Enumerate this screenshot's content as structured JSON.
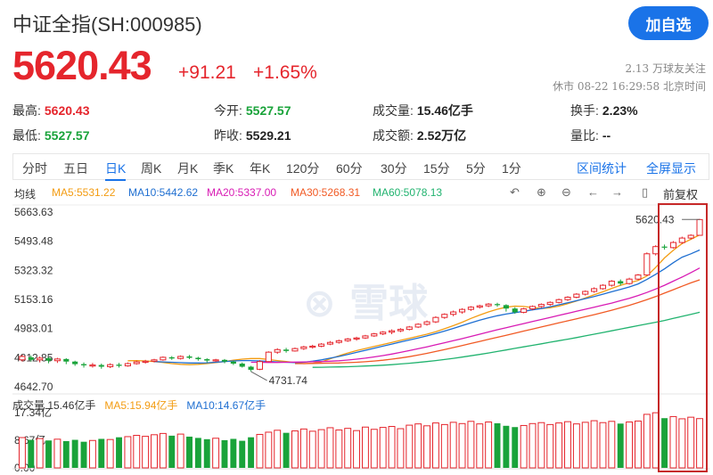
{
  "header": {
    "title": "中证全指(SH:000985)",
    "add_button": "加自选",
    "price": "5620.43",
    "change": "+91.21",
    "change_pct": "+1.65%",
    "followers": "2.13 万球友关注",
    "status": "休市 08-22 16:29:58 北京时间"
  },
  "stats": [
    {
      "label": "最高:",
      "value": "5620.43",
      "tone": "red"
    },
    {
      "label": "今开:",
      "value": "5527.57",
      "tone": "green"
    },
    {
      "label": "成交量:",
      "value": "15.46亿手",
      "tone": "dark"
    },
    {
      "label": "换手:",
      "value": "2.23%",
      "tone": "dark"
    },
    {
      "label": "最低:",
      "value": "5527.57",
      "tone": "green"
    },
    {
      "label": "昨收:",
      "value": "5529.21",
      "tone": "dark"
    },
    {
      "label": "成交额:",
      "value": "2.52万亿",
      "tone": "dark"
    },
    {
      "label": "量比:",
      "value": "--",
      "tone": "dark"
    }
  ],
  "tabs": [
    "分时",
    "五日",
    "日K",
    "周K",
    "月K",
    "季K",
    "年K",
    "120分",
    "60分",
    "30分",
    "15分",
    "5分",
    "1分"
  ],
  "active_tab": "日K",
  "tab_links": [
    "区间统计",
    "全屏显示"
  ],
  "ma_legend": {
    "label": "均线",
    "items": [
      {
        "text": "MA5:5531.22",
        "color": "#f39c12"
      },
      {
        "text": "MA10:5442.62",
        "color": "#1f6fd1"
      },
      {
        "text": "MA20:5337.00",
        "color": "#d81bb4"
      },
      {
        "text": "MA30:5268.31",
        "color": "#f15a24"
      },
      {
        "text": "MA60:5078.13",
        "color": "#21b36f"
      }
    ],
    "adjust": "前复权"
  },
  "colors": {
    "up": "#e5252c",
    "down": "#19a33a",
    "accent": "#1a73e8"
  },
  "volume_legend": [
    {
      "text": "成交量 15.46亿手",
      "color": "#333333"
    },
    {
      "text": "MA5:15.94亿手",
      "color": "#f39c12"
    },
    {
      "text": "MA10:14.67亿手",
      "color": "#1f6fd1"
    }
  ],
  "chart_data": {
    "type": "candlestick",
    "y_ticks": [
      "5663.63",
      "5493.48",
      "5323.32",
      "5153.16",
      "4983.01",
      "4812.85",
      "4642.70"
    ],
    "y_range": [
      4642.7,
      5663.63
    ],
    "high_marker": "5620.43",
    "low_marker": "4731.74",
    "volume_ticks": [
      "17.34亿",
      "8.67亿",
      "0.00"
    ],
    "volume_range": [
      0,
      17.34
    ],
    "candles": [
      [
        4800,
        4820,
        4790,
        4830
      ],
      [
        4815,
        4800,
        4790,
        4825
      ],
      [
        4800,
        4810,
        4785,
        4820
      ],
      [
        4810,
        4795,
        4780,
        4818
      ],
      [
        4795,
        4805,
        4782,
        4812
      ],
      [
        4805,
        4790,
        4775,
        4810
      ],
      [
        4790,
        4775,
        4765,
        4795
      ],
      [
        4775,
        4768,
        4755,
        4785
      ],
      [
        4768,
        4770,
        4755,
        4782
      ],
      [
        4770,
        4760,
        4748,
        4778
      ],
      [
        4760,
        4772,
        4752,
        4780
      ],
      [
        4772,
        4765,
        4755,
        4782
      ],
      [
        4765,
        4778,
        4760,
        4785
      ],
      [
        4778,
        4788,
        4772,
        4795
      ],
      [
        4788,
        4792,
        4778,
        4800
      ],
      [
        4792,
        4800,
        4785,
        4806
      ],
      [
        4800,
        4815,
        4795,
        4820
      ],
      [
        4815,
        4808,
        4800,
        4822
      ],
      [
        4808,
        4820,
        4802,
        4826
      ],
      [
        4820,
        4812,
        4805,
        4828
      ],
      [
        4812,
        4804,
        4795,
        4818
      ],
      [
        4804,
        4796,
        4785,
        4810
      ],
      [
        4796,
        4800,
        4788,
        4806
      ],
      [
        4800,
        4790,
        4780,
        4805
      ],
      [
        4790,
        4778,
        4770,
        4795
      ],
      [
        4778,
        4760,
        4755,
        4785
      ],
      [
        4760,
        4742,
        4732,
        4765
      ],
      [
        4745,
        4790,
        4740,
        4798
      ],
      [
        4790,
        4845,
        4788,
        4850
      ],
      [
        4845,
        4860,
        4835,
        4868
      ],
      [
        4860,
        4852,
        4842,
        4870
      ],
      [
        4852,
        4866,
        4848,
        4872
      ],
      [
        4866,
        4876,
        4858,
        4882
      ],
      [
        4876,
        4880,
        4866,
        4888
      ],
      [
        4880,
        4892,
        4874,
        4898
      ],
      [
        4892,
        4902,
        4886,
        4910
      ],
      [
        4902,
        4912,
        4895,
        4918
      ],
      [
        4912,
        4922,
        4905,
        4928
      ],
      [
        4922,
        4928,
        4912,
        4935
      ],
      [
        4928,
        4940,
        4922,
        4946
      ],
      [
        4940,
        4952,
        4934,
        4958
      ],
      [
        4952,
        4962,
        4945,
        4968
      ],
      [
        4962,
        4970,
        4950,
        4978
      ],
      [
        4970,
        4978,
        4962,
        4985
      ],
      [
        4978,
        4992,
        4972,
        4998
      ],
      [
        4992,
        5008,
        4986,
        5014
      ],
      [
        5008,
        5022,
        5000,
        5030
      ],
      [
        5022,
        5048,
        5015,
        5055
      ],
      [
        5048,
        5066,
        5040,
        5072
      ],
      [
        5066,
        5080,
        5055,
        5088
      ],
      [
        5080,
        5095,
        5070,
        5102
      ],
      [
        5095,
        5108,
        5086,
        5114
      ],
      [
        5108,
        5116,
        5100,
        5122
      ],
      [
        5116,
        5126,
        5108,
        5132
      ],
      [
        5126,
        5120,
        5110,
        5134
      ],
      [
        5120,
        5100,
        5082,
        5125
      ],
      [
        5100,
        5078,
        5070,
        5108
      ],
      [
        5078,
        5098,
        5072,
        5104
      ],
      [
        5098,
        5112,
        5090,
        5118
      ],
      [
        5112,
        5124,
        5104,
        5130
      ],
      [
        5124,
        5136,
        5116,
        5142
      ],
      [
        5136,
        5152,
        5130,
        5158
      ],
      [
        5152,
        5166,
        5144,
        5172
      ],
      [
        5166,
        5184,
        5160,
        5190
      ],
      [
        5184,
        5200,
        5176,
        5206
      ],
      [
        5200,
        5216,
        5192,
        5224
      ],
      [
        5216,
        5236,
        5210,
        5242
      ],
      [
        5236,
        5260,
        5228,
        5266
      ],
      [
        5260,
        5246,
        5234,
        5270
      ],
      [
        5246,
        5272,
        5240,
        5280
      ],
      [
        5272,
        5296,
        5266,
        5302
      ],
      [
        5296,
        5420,
        5292,
        5428
      ],
      [
        5420,
        5462,
        5410,
        5470
      ],
      [
        5462,
        5456,
        5444,
        5474
      ],
      [
        5456,
        5486,
        5450,
        5494
      ],
      [
        5486,
        5512,
        5478,
        5520
      ],
      [
        5512,
        5528,
        5504,
        5534
      ],
      [
        5528,
        5620,
        5527,
        5624
      ]
    ],
    "volumes": [
      9.5,
      8.8,
      9.2,
      8.6,
      9.0,
      8.4,
      8.8,
      8.2,
      8.6,
      9.1,
      8.9,
      9.6,
      9.8,
      10.2,
      9.9,
      10.4,
      10.8,
      10.1,
      10.6,
      9.8,
      9.4,
      9.0,
      9.3,
      8.7,
      9.1,
      8.5,
      9.6,
      10.5,
      11.2,
      11.8,
      11.0,
      11.6,
      12.2,
      11.5,
      12.0,
      12.6,
      11.9,
      12.4,
      11.7,
      12.8,
      12.1,
      12.7,
      13.0,
      12.3,
      13.4,
      13.8,
      13.2,
      14.1,
      13.6,
      14.3,
      13.9,
      14.6,
      13.8,
      14.4,
      14.0,
      13.2,
      12.8,
      13.3,
      13.9,
      14.2,
      13.6,
      14.1,
      14.5,
      13.8,
      14.3,
      14.8,
      14.2,
      14.6,
      13.9,
      14.4,
      14.7,
      16.8,
      17.3,
      15.6,
      16.1,
      15.4,
      15.9,
      15.46
    ],
    "ma": [
      {
        "name": "MA5",
        "color": "#f39c12",
        "points": [
          4795,
          4796,
          4794,
          4790,
          4785,
          4778,
          4774,
          4772,
          4774,
          4778,
          4784,
          4790,
          4798,
          4804,
          4808,
          4808,
          4802,
          4796,
          4790,
          4784,
          4778,
          4780,
          4788,
          4806,
          4824,
          4840,
          4854,
          4866,
          4878,
          4890,
          4902,
          4914,
          4926,
          4938,
          4950,
          4964,
          4982,
          5000,
          5020,
          5042,
          5062,
          5080,
          5096,
          5108,
          5114,
          5112,
          5106,
          5100,
          5104,
          5114,
          5128,
          5144,
          5162,
          5180,
          5198,
          5218,
          5236,
          5250,
          5264,
          5290,
          5340,
          5396,
          5440,
          5480,
          5505,
          5531
        ]
      },
      {
        "name": "MA10",
        "color": "#1f6fd1",
        "points": [
          4790,
          4788,
          4786,
          4784,
          4782,
          4782,
          4783,
          4786,
          4790,
          4794,
          4796,
          4796,
          4794,
          4791,
          4788,
          4786,
          4784,
          4786,
          4792,
          4800,
          4810,
          4820,
          4832,
          4844,
          4856,
          4868,
          4880,
          4892,
          4904,
          4916,
          4928,
          4940,
          4954,
          4968,
          4984,
          5000,
          5016,
          5032,
          5046,
          5058,
          5068,
          5076,
          5084,
          5092,
          5100,
          5110,
          5122,
          5134,
          5146,
          5158,
          5170,
          5184,
          5198,
          5212,
          5226,
          5244,
          5270,
          5300,
          5332,
          5368,
          5400,
          5420,
          5442
        ]
      },
      {
        "name": "MA20",
        "color": "#d81bb4",
        "points": [
          4786,
          4786,
          4785,
          4785,
          4786,
          4787,
          4788,
          4789,
          4790,
          4792,
          4795,
          4799,
          4804,
          4810,
          4817,
          4825,
          4834,
          4844,
          4854,
          4865,
          4876,
          4888,
          4900,
          4912,
          4924,
          4937,
          4950,
          4963,
          4976,
          4988,
          5000,
          5012,
          5024,
          5036,
          5048,
          5060,
          5072,
          5084,
          5096,
          5108,
          5120,
          5132,
          5146,
          5160,
          5176,
          5194,
          5214,
          5236,
          5260,
          5284,
          5310,
          5337
        ]
      },
      {
        "name": "MA30",
        "color": "#f15a24",
        "points": [
          4778,
          4778,
          4779,
          4780,
          4781,
          4782,
          4784,
          4786,
          4789,
          4793,
          4798,
          4804,
          4811,
          4819,
          4828,
          4838,
          4849,
          4860,
          4872,
          4884,
          4896,
          4908,
          4920,
          4932,
          4944,
          4956,
          4968,
          4980,
          4992,
          5004,
          5016,
          5028,
          5040,
          5052,
          5064,
          5077,
          5090,
          5104,
          5119,
          5135,
          5152,
          5170,
          5190,
          5210,
          5230,
          5250,
          5268
        ]
      },
      {
        "name": "MA60",
        "color": "#21b36f",
        "points": [
          4756,
          4757,
          4758,
          4759,
          4760,
          4762,
          4764,
          4766,
          4769,
          4772,
          4776,
          4780,
          4785,
          4790,
          4796,
          4802,
          4809,
          4816,
          4824,
          4832,
          4840,
          4849,
          4858,
          4867,
          4876,
          4885,
          4894,
          4903,
          4912,
          4921,
          4930,
          4940,
          4950,
          4960,
          4970,
          4980,
          4990,
          5000,
          5010,
          5020,
          5030,
          5042,
          5054,
          5066,
          5078
        ]
      }
    ]
  }
}
